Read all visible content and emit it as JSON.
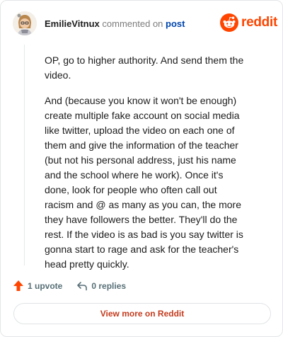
{
  "comment": {
    "username": "EmilieVitnux",
    "action_text": "commented on",
    "post_link_label": "post",
    "paragraphs": [
      "OP, go to higher authority. And send them the video.",
      "And (because you know it won't be enough) create multiple fake account on social media like twitter, upload the video on each one of them and give the information of the teacher (but not his personal address, just his name and the school where he work). Once it's done, look for people who often call out racism and @ as many as you can, the more they have followers the better. They'll do the rest. If the video is as bad is you say twitter is gonna start to rage and ask for the teacher's head pretty quickly."
    ]
  },
  "brand": {
    "name": "reddit",
    "icon": "reddit-snoo-icon",
    "color": "#ff4500"
  },
  "actions": {
    "upvote_label": "1 upvote",
    "upvote_icon": "upvote-arrow-icon",
    "replies_label": "0 replies",
    "reply_icon": "reply-arrow-icon"
  },
  "footer": {
    "view_more_label": "View more on Reddit"
  }
}
